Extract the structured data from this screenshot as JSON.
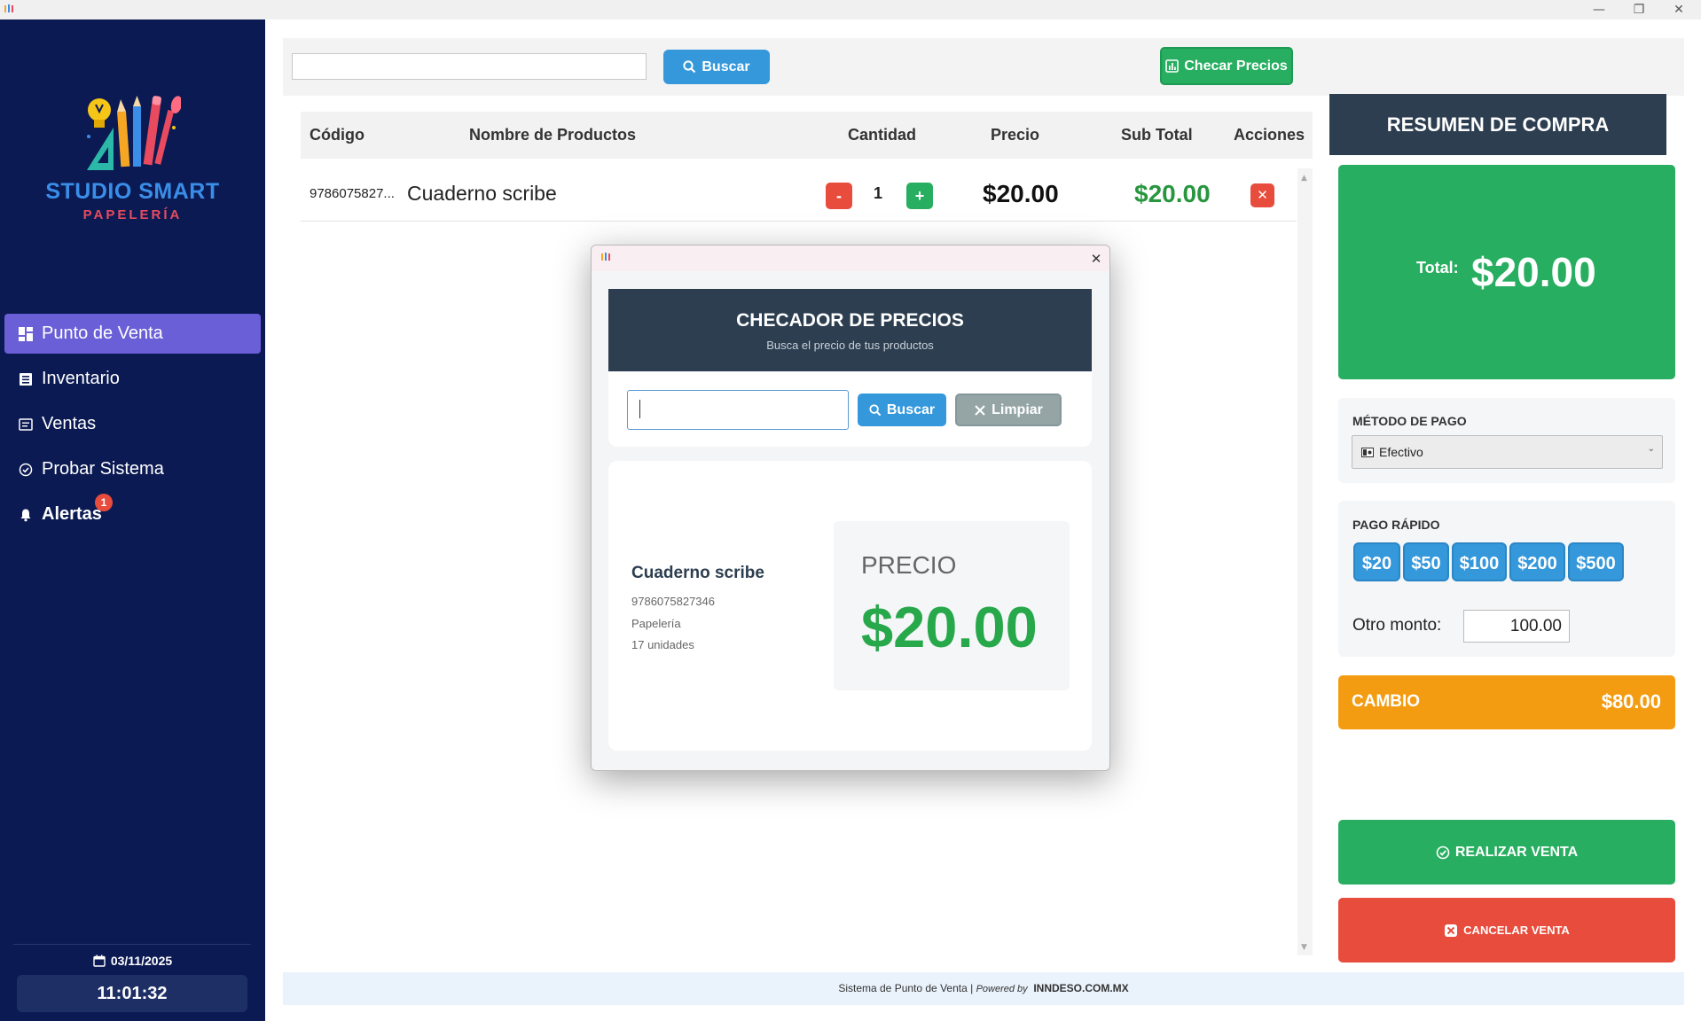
{
  "window": {
    "minimize_icon": "minimize-icon",
    "maximize_icon": "restore-icon",
    "close_icon": "close-icon"
  },
  "sidebar": {
    "logo_title": "STUDIO SMART",
    "logo_subtitle": "PAPELERÍA",
    "items": [
      {
        "label": "Punto de Venta",
        "icon": "dashboard-icon",
        "active": true
      },
      {
        "label": "Inventario",
        "icon": "list-icon",
        "active": false
      },
      {
        "label": "Ventas",
        "icon": "receipt-icon",
        "active": false
      },
      {
        "label": "Probar Sistema",
        "icon": "check-circle-icon",
        "active": false
      },
      {
        "label": "Alertas",
        "icon": "bell-icon",
        "active": false
      }
    ],
    "alert_count": "1",
    "date": "03/11/2025",
    "time": "11:01:32"
  },
  "topbar": {
    "search_value": "",
    "search_button": "Buscar",
    "check_prices_button": "Checar Precios"
  },
  "table": {
    "headers": [
      "Código",
      "Nombre de Productos",
      "Cantidad",
      "Precio",
      "Sub Total",
      "Acciones"
    ],
    "rows": [
      {
        "code": "9786075827...",
        "name": "Cuaderno scribe",
        "minus": "-",
        "qty": "1",
        "plus": "+",
        "price": "$20.00",
        "subtotal": "$20.00",
        "delete": "✕"
      }
    ]
  },
  "summary": {
    "header": "RESUMEN DE COMPRA",
    "total_label": "Total:",
    "total_value": "$20.00",
    "payment_method_title": "MÉTODO DE PAGO",
    "payment_method_value": "Efectivo",
    "quick_pay_title": "PAGO RÁPIDO",
    "quick_pay_options": [
      "$20",
      "$50",
      "$100",
      "$200",
      "$500"
    ],
    "other_amount_label": "Otro monto:",
    "other_amount_value": "100.00",
    "change_label": "CAMBIO",
    "change_value": "$80.00",
    "complete_sale_button": "REALIZAR VENTA",
    "cancel_sale_button": "CANCELAR VENTA"
  },
  "footer": {
    "text_prefix": "Sistema de Punto de Venta | ",
    "powered_by": "Powered by",
    "brand": "INNDESO.COM.MX"
  },
  "modal": {
    "title": "CHECADOR DE PRECIOS",
    "subtitle": "Busca el precio de tus productos",
    "search_value": "",
    "search_button": "Buscar",
    "clear_button": "Limpiar",
    "product": {
      "name": "Cuaderno scribe",
      "code": "9786075827346",
      "category": "Papelería",
      "stock": "17 unidades"
    },
    "price_label": "PRECIO",
    "price_value": "$20.00"
  },
  "colors": {
    "sidebar_bg": "#0b1a53",
    "active_nav": "#6a5fd6",
    "primary_blue": "#3498db",
    "success_green": "#27ae60",
    "danger_red": "#e74c3c",
    "warning_orange": "#f39c12",
    "dark_header": "#2c3e50"
  }
}
